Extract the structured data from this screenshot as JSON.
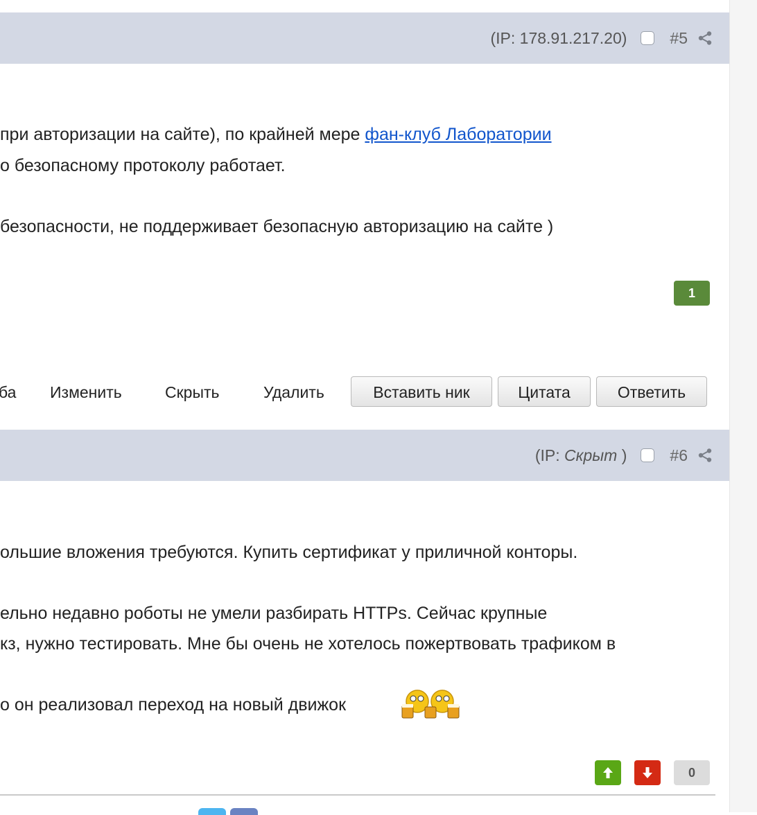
{
  "post5": {
    "ip_label": "(IP: 178.91.217.20)",
    "number": "#5",
    "lines": {
      "l1_text": "при авторизации на сайте), по крайней мере ",
      "l1_link": "фан-клуб Лаборатории",
      "l2": "о безопасному протоколу работает.",
      "l3": "безопасности, не поддерживает безопасную авторизацию на сайте )"
    },
    "rating": "1",
    "actions": {
      "cut_link": "ба",
      "edit": "Изменить",
      "hide": "Скрыть",
      "delete": "Удалить",
      "insert_nick": "Вставить ник",
      "quote": "Цитата",
      "reply": "Ответить"
    }
  },
  "post6": {
    "ip_prefix": "(IP: ",
    "ip_value": "Скрыт",
    "ip_suffix": " )",
    "number": "#6",
    "lines": {
      "l1": "ольшие вложения требуются. Купить сертификат у приличной конторы.",
      "l2": "ельно недавно роботы не умели разбирать HTTPs. Сейчас крупные",
      "l3": "кз, нужно тестировать. Мне бы очень не хотелось пожертвовать трафиком в",
      "l4": "о он реализовал переход на новый движок"
    },
    "vote_count": "0"
  },
  "colors": {
    "header_bg": "#d3d8e4",
    "rating_green": "#5a8a3a",
    "vote_up": "#5aa716",
    "vote_down": "#d42a14",
    "link": "#1155cc"
  },
  "icons": [
    "share-icon",
    "checkbox",
    "beer-smiley-icon",
    "arrow-up-icon",
    "arrow-down-icon"
  ]
}
